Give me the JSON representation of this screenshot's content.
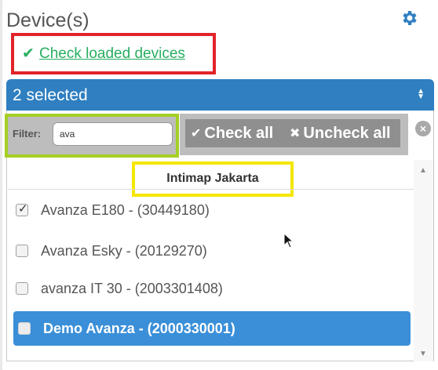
{
  "panel": {
    "title": "Device(s)",
    "settings_icon": "gear-icon",
    "accent": "#2f7fc1"
  },
  "check_loaded": {
    "icon": "check-icon",
    "label": "Check loaded devices"
  },
  "select": {
    "value": "2 selected",
    "caret_icon": "sort-caret-icon"
  },
  "filter": {
    "label": "Filter:",
    "value": "ava"
  },
  "actions": {
    "check_all": "Check all",
    "uncheck_all": "Uncheck all",
    "close_icon": "close-circle-icon"
  },
  "group": {
    "label": "Intimap Jakarta"
  },
  "items": [
    {
      "label": "Avanza E180 - (30449180)",
      "checked": true,
      "active": false
    },
    {
      "label": "Avanza Esky - (20129270)",
      "checked": false,
      "active": false
    },
    {
      "label": "avanza IT 30 - (2003301408)",
      "checked": false,
      "active": false
    },
    {
      "label": "Demo Avanza - (2000330001)",
      "checked": false,
      "active": true
    }
  ],
  "highlight_colors": {
    "check_loaded": "#e2232a",
    "filter": "#a5cf24",
    "group": "#f5e600"
  }
}
